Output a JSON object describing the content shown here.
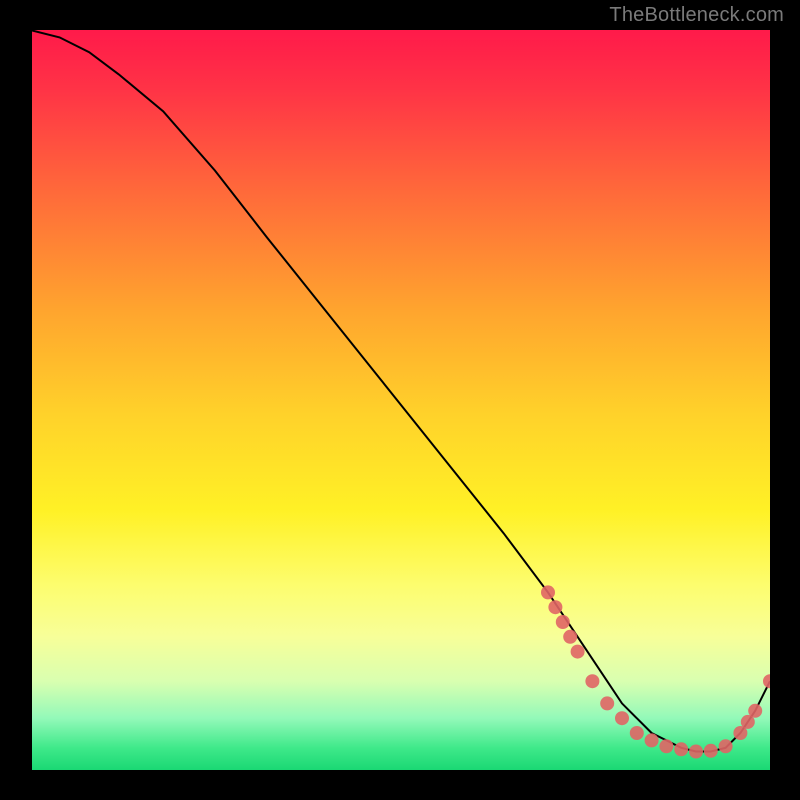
{
  "watermark": "TheBottleneck.com",
  "chart_data": {
    "type": "line",
    "title": "",
    "xlabel": "",
    "ylabel": "",
    "xlim": [
      0,
      100
    ],
    "ylim": [
      0,
      100
    ],
    "x": [
      0,
      4,
      8,
      12,
      18,
      25,
      32,
      40,
      48,
      56,
      64,
      70,
      74,
      78,
      80,
      82,
      84,
      86,
      88,
      90,
      92,
      94,
      96,
      98,
      100
    ],
    "values": [
      100,
      99,
      97,
      94,
      89,
      81,
      72,
      62,
      52,
      42,
      32,
      24,
      18,
      12,
      9,
      7,
      5,
      4,
      3,
      2.5,
      2.5,
      3,
      5,
      8,
      12
    ],
    "markers": [
      {
        "x": 70,
        "y": 24
      },
      {
        "x": 71,
        "y": 22
      },
      {
        "x": 72,
        "y": 20
      },
      {
        "x": 73,
        "y": 18
      },
      {
        "x": 74,
        "y": 16
      },
      {
        "x": 76,
        "y": 12
      },
      {
        "x": 78,
        "y": 9
      },
      {
        "x": 80,
        "y": 7
      },
      {
        "x": 82,
        "y": 5
      },
      {
        "x": 84,
        "y": 4
      },
      {
        "x": 86,
        "y": 3.2
      },
      {
        "x": 88,
        "y": 2.8
      },
      {
        "x": 90,
        "y": 2.5
      },
      {
        "x": 92,
        "y": 2.6
      },
      {
        "x": 94,
        "y": 3.2
      },
      {
        "x": 96,
        "y": 5
      },
      {
        "x": 97,
        "y": 6.5
      },
      {
        "x": 98,
        "y": 8
      },
      {
        "x": 100,
        "y": 12
      }
    ],
    "marker_color": "#e06565",
    "line_color": "#000000"
  }
}
